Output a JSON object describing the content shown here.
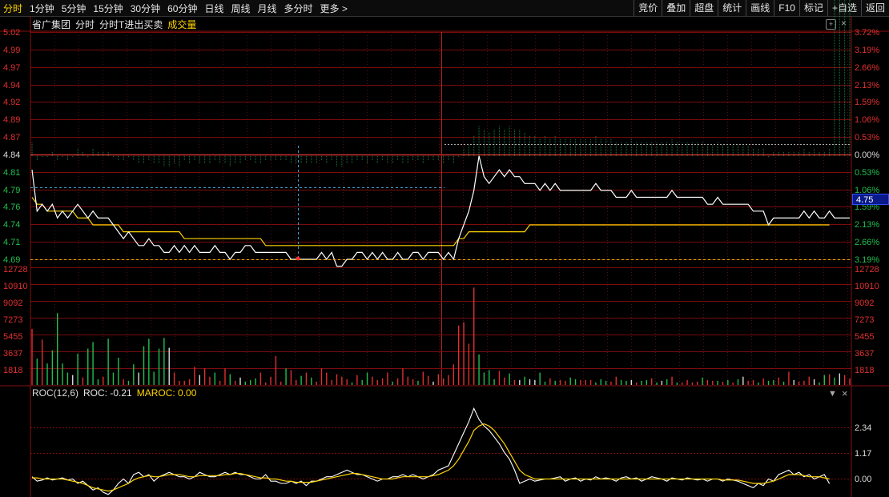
{
  "toolbar": {
    "periods": [
      "分时",
      "1分钟",
      "5分钟",
      "15分钟",
      "30分钟",
      "60分钟",
      "日线",
      "周线",
      "月线",
      "多分时",
      "更多 >"
    ],
    "active_index": 0,
    "right_buttons": [
      "竞价",
      "叠加",
      "超盘",
      "统计",
      "画线",
      "F10",
      "标记",
      "+自选",
      "返回"
    ]
  },
  "info_bar": {
    "stock_name": "省广集团",
    "mode": "分时",
    "indicator": "分时T进出买卖",
    "volume_label": "成交量"
  },
  "icons": {
    "settings": "circle-plus-icon",
    "close": "close-icon"
  },
  "price_axis": {
    "left": [
      "5.02",
      "4.99",
      "4.97",
      "4.94",
      "4.92",
      "4.89",
      "4.87",
      "4.84",
      "4.81",
      "4.79",
      "4.76",
      "4.74",
      "4.71",
      "4.69"
    ],
    "right": [
      "3.72%",
      "3.19%",
      "2.66%",
      "2.13%",
      "1.59%",
      "1.06%",
      "0.53%",
      "0.00%",
      "0.53%",
      "1.06%",
      "1.59%",
      "2.13%",
      "2.66%",
      "3.19%"
    ],
    "current_price": "4.75"
  },
  "volume_axis": {
    "labels": [
      "12728",
      "10910",
      "9092",
      "7273",
      "5455",
      "3637",
      "1818"
    ]
  },
  "roc_panel": {
    "name": "ROC(12,6)",
    "roc_text": "ROC: -0.21",
    "maroc_text": "MAROC: 0.00",
    "axis": [
      "2.34",
      "1.17",
      "0.00"
    ],
    "dropdown_icon": "triangle-down-icon",
    "close_icon": "close-icon"
  },
  "colors": {
    "up": "#e03030",
    "down": "#20c050",
    "flat": "#dcdcdc",
    "avg": "#ffd400",
    "grid": "#8a1010"
  },
  "chart_data": {
    "type": "line",
    "title": "省广集团 分时",
    "prev_close": 4.84,
    "ylim": [
      4.68,
      5.02
    ],
    "price": [
      4.82,
      4.76,
      4.77,
      4.76,
      4.77,
      4.75,
      4.76,
      4.75,
      4.76,
      4.77,
      4.76,
      4.75,
      4.76,
      4.75,
      4.75,
      4.75,
      4.74,
      4.73,
      4.72,
      4.73,
      4.72,
      4.71,
      4.71,
      4.72,
      4.71,
      4.71,
      4.7,
      4.7,
      4.71,
      4.7,
      4.71,
      4.7,
      4.71,
      4.7,
      4.7,
      4.7,
      4.71,
      4.7,
      4.7,
      4.69,
      4.7,
      4.7,
      4.71,
      4.71,
      4.7,
      4.7,
      4.7,
      4.7,
      4.7,
      4.7,
      4.7,
      4.69,
      4.69,
      4.69,
      4.69,
      4.69,
      4.69,
      4.7,
      4.69,
      4.7,
      4.68,
      4.68,
      4.69,
      4.69,
      4.7,
      4.7,
      4.69,
      4.7,
      4.69,
      4.7,
      4.69,
      4.69,
      4.7,
      4.69,
      4.69,
      4.7,
      4.7,
      4.69,
      4.7,
      4.7,
      4.7,
      4.69,
      4.7,
      4.69,
      4.72,
      4.74,
      4.76,
      4.79,
      4.84,
      4.81,
      4.8,
      4.81,
      4.82,
      4.81,
      4.82,
      4.81,
      4.81,
      4.8,
      4.8,
      4.8,
      4.79,
      4.8,
      4.79,
      4.8,
      4.79,
      4.79,
      4.79,
      4.79,
      4.79,
      4.79,
      4.79,
      4.8,
      4.79,
      4.79,
      4.79,
      4.78,
      4.78,
      4.78,
      4.79,
      4.78,
      4.78,
      4.78,
      4.78,
      4.78,
      4.78,
      4.78,
      4.79,
      4.78,
      4.78,
      4.78,
      4.78,
      4.78,
      4.78,
      4.77,
      4.77,
      4.78,
      4.77,
      4.77,
      4.77,
      4.77,
      4.77,
      4.77,
      4.76,
      4.76,
      4.76,
      4.74,
      4.75,
      4.75,
      4.75,
      4.75,
      4.75,
      4.75,
      4.76,
      4.75,
      4.76,
      4.75,
      4.75,
      4.76,
      4.75,
      4.75,
      4.75,
      4.75
    ],
    "avg_price": [
      4.78,
      4.77,
      4.77,
      4.76,
      4.76,
      4.76,
      4.76,
      4.76,
      4.76,
      4.75,
      4.75,
      4.75,
      4.74,
      4.74,
      4.74,
      4.74,
      4.74,
      4.74,
      4.73,
      4.73,
      4.73,
      4.73,
      4.73,
      4.73,
      4.73,
      4.73,
      4.73,
      4.73,
      4.73,
      4.73,
      4.72,
      4.72,
      4.72,
      4.72,
      4.72,
      4.72,
      4.72,
      4.72,
      4.72,
      4.72,
      4.72,
      4.72,
      4.72,
      4.72,
      4.72,
      4.72,
      4.71,
      4.71,
      4.71,
      4.71,
      4.71,
      4.71,
      4.71,
      4.71,
      4.71,
      4.71,
      4.71,
      4.71,
      4.71,
      4.71,
      4.71,
      4.71,
      4.71,
      4.71,
      4.71,
      4.71,
      4.71,
      4.71,
      4.71,
      4.71,
      4.71,
      4.71,
      4.71,
      4.71,
      4.71,
      4.71,
      4.71,
      4.71,
      4.71,
      4.71,
      4.71,
      4.71,
      4.71,
      4.71,
      4.72,
      4.72,
      4.73,
      4.73,
      4.73,
      4.73,
      4.73,
      4.73,
      4.73,
      4.73,
      4.73,
      4.73,
      4.73,
      4.73,
      4.74,
      4.74,
      4.74,
      4.74,
      4.74,
      4.74,
      4.74,
      4.74,
      4.74,
      4.74,
      4.74,
      4.74,
      4.74,
      4.74,
      4.74,
      4.74,
      4.74,
      4.74,
      4.74,
      4.74,
      4.74,
      4.74,
      4.74,
      4.74,
      4.74,
      4.74,
      4.74,
      4.74,
      4.74,
      4.74,
      4.74,
      4.74,
      4.74,
      4.74,
      4.74,
      4.74,
      4.74,
      4.74,
      4.74,
      4.74,
      4.74,
      4.74,
      4.74,
      4.74,
      4.74,
      4.74,
      4.74,
      4.74,
      4.74,
      4.74,
      4.74,
      4.74,
      4.74,
      4.74,
      4.74,
      4.74,
      4.74,
      4.74,
      4.74,
      4.74
    ],
    "volume": [
      6800,
      3200,
      5500,
      2600,
      4200,
      8700,
      2600,
      1500,
      1200,
      3800,
      900,
      4400,
      5200,
      700,
      1000,
      5600,
      1500,
      3300,
      700,
      500,
      2500,
      1500,
      4700,
      5600,
      1600,
      4400,
      5700,
      4500,
      1500,
      500,
      500,
      700,
      2200,
      1200,
      2000,
      1000,
      1500,
      500,
      2000,
      1300,
      500,
      900,
      400,
      600,
      800,
      1500,
      300,
      1000,
      3500,
      400,
      2000,
      1800,
      600,
      1100,
      1500,
      900,
      400,
      2000,
      1500,
      600,
      1300,
      1000,
      700,
      300,
      1200,
      600,
      1500,
      1000,
      600,
      800,
      1500,
      400,
      800,
      2000,
      1000,
      700,
      500,
      1600,
      1100,
      400,
      1300,
      800,
      1200,
      2500,
      7200,
      7600,
      5000,
      11800,
      3700,
      1500,
      1800,
      700,
      1700,
      900,
      1400,
      600,
      600,
      1000,
      700,
      600,
      1500,
      400,
      800,
      500,
      600,
      500,
      900,
      700,
      600,
      600,
      600,
      300,
      700,
      500,
      400,
      1000,
      600,
      500,
      600,
      300,
      500,
      600,
      800,
      300,
      500,
      700,
      1000,
      300,
      300,
      600,
      300,
      400,
      900,
      600,
      500,
      500,
      400,
      600,
      300,
      700,
      1000,
      500,
      600,
      300,
      800,
      500,
      600,
      900,
      400,
      1600,
      600,
      400,
      500,
      1000,
      700,
      300,
      1200,
      1300,
      900,
      1400,
      1200,
      800,
      2000
    ],
    "volume_dir": [
      1,
      -1,
      1,
      -1,
      -1,
      -1,
      -1,
      -1,
      0,
      -1,
      1,
      -1,
      -1,
      -1,
      1,
      -1,
      -1,
      -1,
      1,
      -1,
      -1,
      0,
      -1,
      -1,
      -1,
      -1,
      -1,
      0,
      1,
      1,
      1,
      1,
      1,
      0,
      1,
      1,
      -1,
      1,
      1,
      -1,
      1,
      0,
      -1,
      -1,
      -1,
      1,
      1,
      1,
      1,
      1,
      -1,
      1,
      1,
      -1,
      1,
      -1,
      1,
      1,
      1,
      1,
      1,
      1,
      1,
      -1,
      1,
      -1,
      -1,
      1,
      1,
      1,
      1,
      -1,
      1,
      1,
      1,
      1,
      -1,
      1,
      1,
      0,
      1,
      1,
      1,
      1,
      1,
      1,
      1,
      1,
      -1,
      -1,
      -1,
      -1,
      1,
      1,
      -1,
      1,
      0,
      -1,
      0,
      0,
      -1,
      -1,
      1,
      -1,
      1,
      1,
      -1,
      -1,
      1,
      1,
      1,
      -1,
      -1,
      -1,
      1,
      1,
      -1,
      -1,
      0,
      1,
      -1,
      -1,
      1,
      -1,
      0,
      -1,
      1,
      -1,
      1,
      1,
      1,
      1,
      -1,
      1,
      1,
      -1,
      1,
      -1,
      1,
      -1,
      0,
      1,
      1,
      -1,
      1,
      -1,
      -1,
      1,
      -1,
      1,
      0,
      1,
      1,
      1,
      0,
      -1,
      -1,
      1,
      -1,
      0,
      1,
      1
    ],
    "roc": [
      0.1,
      -0.1,
      -0.05,
      0.05,
      -0.05,
      0.0,
      0.05,
      -0.05,
      0.0,
      -0.2,
      -0.1,
      -0.3,
      -0.5,
      -0.4,
      -0.6,
      -0.7,
      -0.5,
      -0.2,
      0.0,
      -0.2,
      0.2,
      0.3,
      0.1,
      0.2,
      -0.1,
      0.1,
      0.2,
      0.3,
      0.2,
      0.1,
      0.1,
      0.0,
      0.1,
      0.3,
      0.2,
      0.1,
      0.1,
      0.2,
      0.3,
      0.2,
      0.3,
      0.2,
      0.2,
      0.1,
      0.0,
      0.0,
      0.2,
      -0.1,
      -0.1,
      -0.2,
      -0.2,
      -0.1,
      -0.2,
      -0.1,
      -0.3,
      -0.1,
      -0.1,
      0.0,
      0.1,
      0.1,
      0.2,
      0.3,
      0.4,
      0.3,
      0.2,
      0.2,
      0.1,
      0.0,
      -0.1,
      0.0,
      0.0,
      0.1,
      0.1,
      0.2,
      0.1,
      0.2,
      0.1,
      0.0,
      0.1,
      0.2,
      0.4,
      0.5,
      0.6,
      1.1,
      1.6,
      2.1,
      2.6,
      3.2,
      2.7,
      2.4,
      2.2,
      1.9,
      1.6,
      1.2,
      0.9,
      0.4,
      -0.2,
      -0.1,
      0.0,
      -0.1,
      -0.05,
      0.0,
      0.0,
      0.05,
      0.1,
      -0.1,
      0.0,
      0.05,
      -0.1,
      0.0,
      -0.05,
      0.1,
      0.0,
      0.05,
      0.0,
      -0.1,
      0.05,
      0.1,
      0.0,
      0.05,
      -0.1,
      0.0,
      0.1,
      0.05,
      0.0,
      -0.1,
      0.05,
      0.0,
      -0.05,
      0.05,
      0.0,
      -0.05,
      0.0,
      -0.1,
      0.0,
      0.0,
      -0.1,
      0.0,
      -0.05,
      -0.1,
      -0.2,
      -0.3,
      -0.4,
      -0.2,
      -0.3,
      0.0,
      -0.1,
      0.2,
      0.3,
      0.4,
      0.2,
      0.3,
      0.1,
      0.2,
      0.0,
      0.1,
      0.2,
      -0.21
    ],
    "maroc": [
      0.05,
      0.05,
      0.0,
      0.0,
      0.0,
      0.0,
      0.0,
      -0.05,
      -0.1,
      -0.15,
      -0.2,
      -0.3,
      -0.4,
      -0.45,
      -0.5,
      -0.55,
      -0.5,
      -0.4,
      -0.3,
      -0.2,
      -0.05,
      0.05,
      0.1,
      0.15,
      0.1,
      0.1,
      0.15,
      0.2,
      0.2,
      0.2,
      0.15,
      0.1,
      0.1,
      0.15,
      0.15,
      0.15,
      0.15,
      0.15,
      0.2,
      0.2,
      0.25,
      0.25,
      0.2,
      0.15,
      0.1,
      0.05,
      0.05,
      0.0,
      0.0,
      -0.05,
      -0.1,
      -0.1,
      -0.15,
      -0.15,
      -0.15,
      -0.15,
      -0.1,
      -0.05,
      0.0,
      0.05,
      0.1,
      0.15,
      0.2,
      0.25,
      0.25,
      0.2,
      0.15,
      0.1,
      0.05,
      0.0,
      0.0,
      0.0,
      0.05,
      0.1,
      0.1,
      0.1,
      0.1,
      0.1,
      0.1,
      0.15,
      0.2,
      0.3,
      0.4,
      0.6,
      0.9,
      1.3,
      1.7,
      2.2,
      2.4,
      2.5,
      2.4,
      2.2,
      1.9,
      1.6,
      1.2,
      0.8,
      0.4,
      0.2,
      0.1,
      0.0,
      0.0,
      0.0,
      0.0,
      0.0,
      0.0,
      0.0,
      0.0,
      0.0,
      0.0,
      0.0,
      0.0,
      0.0,
      0.0,
      0.0,
      0.0,
      0.0,
      0.0,
      0.0,
      0.0,
      0.0,
      0.0,
      0.0,
      0.0,
      0.0,
      0.0,
      0.0,
      0.0,
      0.0,
      0.0,
      0.0,
      0.0,
      0.0,
      0.0,
      0.0,
      0.0,
      0.0,
      -0.05,
      -0.05,
      -0.05,
      -0.05,
      -0.1,
      -0.15,
      -0.2,
      -0.2,
      -0.2,
      -0.15,
      -0.1,
      0.0,
      0.1,
      0.2,
      0.2,
      0.2,
      0.15,
      0.1,
      0.1,
      0.1,
      0.05,
      0.0
    ],
    "roc_ylim": [
      -0.6,
      3.5
    ]
  }
}
